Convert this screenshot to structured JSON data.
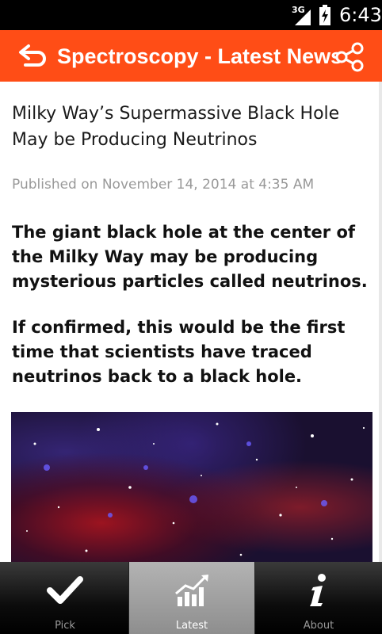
{
  "status_bar": {
    "network": "3G",
    "time": "6:43"
  },
  "action_bar": {
    "title": "Spectroscopy - Latest News",
    "background_color": "#ff4d16",
    "back_icon": "back-arrow-icon",
    "share_icon": "share-icon"
  },
  "article": {
    "headline": "Milky Way’s Supermassive Black Hole May be Producing Neutrinos",
    "published": "Published on November 14, 2014 at 4:35 AM",
    "paragraphs": [
      "The giant black hole at the center of the Milky Way may be producing mysterious particles called neutrinos.",
      "If confirmed, this would be the first time that scientists have traced neutrinos back to a black hole."
    ]
  },
  "tabs": [
    {
      "label": "Pick",
      "icon": "checkmark-icon",
      "active": false
    },
    {
      "label": "Latest",
      "icon": "chart-icon",
      "active": true
    },
    {
      "label": "About",
      "icon": "info-icon",
      "active": false
    }
  ]
}
